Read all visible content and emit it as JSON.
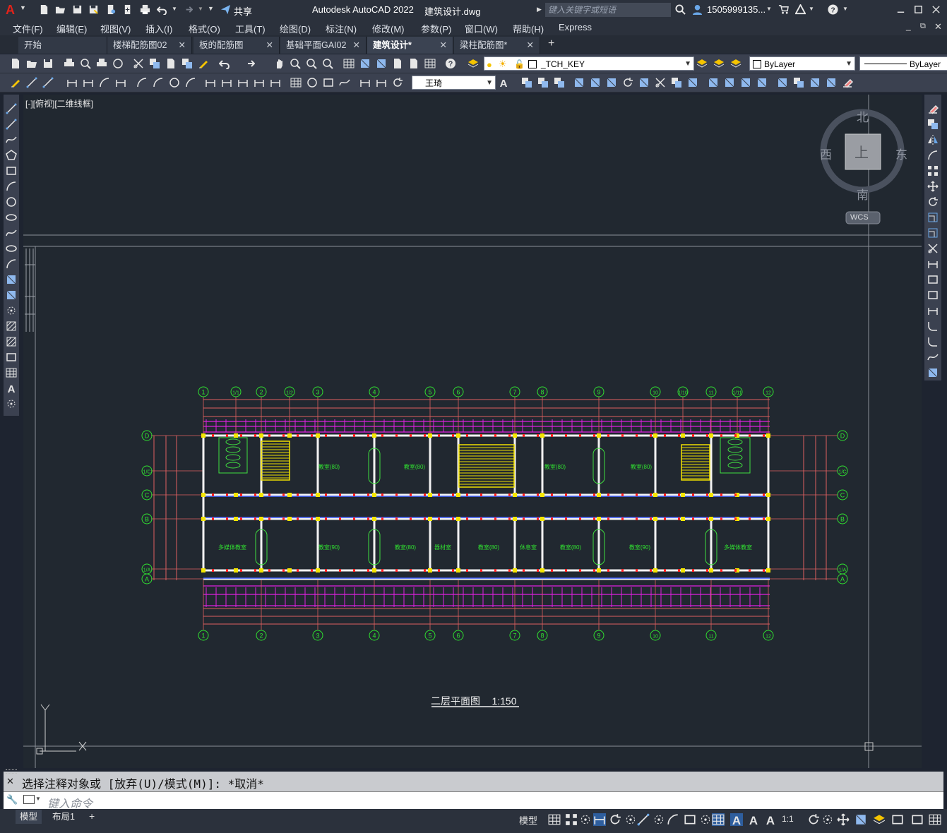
{
  "app": {
    "title": "Autodesk AutoCAD 2022",
    "filename": "建筑设计.dwg",
    "search_placeholder": "键入关键字或短语",
    "user": "1505999135...",
    "share": "共享"
  },
  "menus": [
    "文件(F)",
    "编辑(E)",
    "视图(V)",
    "插入(I)",
    "格式(O)",
    "工具(T)",
    "绘图(D)",
    "标注(N)",
    "修改(M)",
    "参数(P)",
    "窗口(W)",
    "帮助(H)",
    "Express"
  ],
  "tabs": [
    {
      "label": "开始",
      "closable": false
    },
    {
      "label": "楼梯配筋图02",
      "closable": true
    },
    {
      "label": "板的配筋图",
      "closable": true
    },
    {
      "label": "基础平面GAI02",
      "closable": true
    },
    {
      "label": "建筑设计*",
      "closable": true,
      "active": true
    },
    {
      "label": "梁柱配筋图*",
      "closable": true
    }
  ],
  "toolbar": {
    "layer": "_TCH_KEY",
    "color": "ByLayer",
    "linetype": "ByLayer",
    "textstyle": "王琦"
  },
  "viewport": {
    "label": "[-][俯视][二维线框]",
    "compass": {
      "n": "北",
      "s": "南",
      "e": "东",
      "w": "西",
      "top": "上"
    },
    "ucs": "WCS"
  },
  "drawing": {
    "title": "二层平面图",
    "scale": "1:150",
    "grid_top": [
      "1",
      "1/1",
      "2",
      "1/2",
      "3",
      "4",
      "5",
      "6",
      "7",
      "8",
      "9",
      "10",
      "1/10",
      "11",
      "1/11",
      "12"
    ],
    "grid_bottom": [
      "1",
      "2",
      "3",
      "4",
      "5",
      "6",
      "7",
      "8",
      "9",
      "10",
      "11",
      "12"
    ],
    "grid_rows": [
      "D",
      "1/C",
      "C",
      "B",
      "1/A",
      "A"
    ],
    "rooms_top": [
      "教室(80)",
      "教室(80)",
      "教室(80)",
      "教室(80)"
    ],
    "rooms_bottom": [
      "多媒体教室",
      "教室(90)",
      "教室(80)",
      "器材室",
      "教室(80)",
      "休息室",
      "教室(80)",
      "教室(90)",
      "多媒体教室"
    ]
  },
  "command": {
    "history": "选择注释对象或 [放弃(U)/模式(M)]: *取消*",
    "placeholder": "键入命令"
  },
  "status": {
    "layouts": [
      "模型",
      "布局1"
    ],
    "model": "模型",
    "scale": "1:1"
  }
}
